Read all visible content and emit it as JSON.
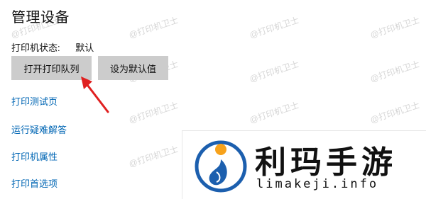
{
  "page": {
    "title": "管理设备"
  },
  "status": {
    "label": "打印机状态:",
    "value": "默认"
  },
  "buttons": {
    "open_queue": "打开打印队列",
    "set_default": "设为默认值"
  },
  "links": [
    "打印测试页",
    "运行疑难解答",
    "打印机属性",
    "打印首选项"
  ],
  "watermark": {
    "text": "@打印机卫士"
  },
  "logo": {
    "name": "利玛手游",
    "domain": "limakeji.info"
  },
  "colors": {
    "link": "#0066b4",
    "arrow": "#e02020",
    "button": "#cccccc",
    "logo_blue": "#1c5fae",
    "logo_orange": "#f7a21b"
  }
}
